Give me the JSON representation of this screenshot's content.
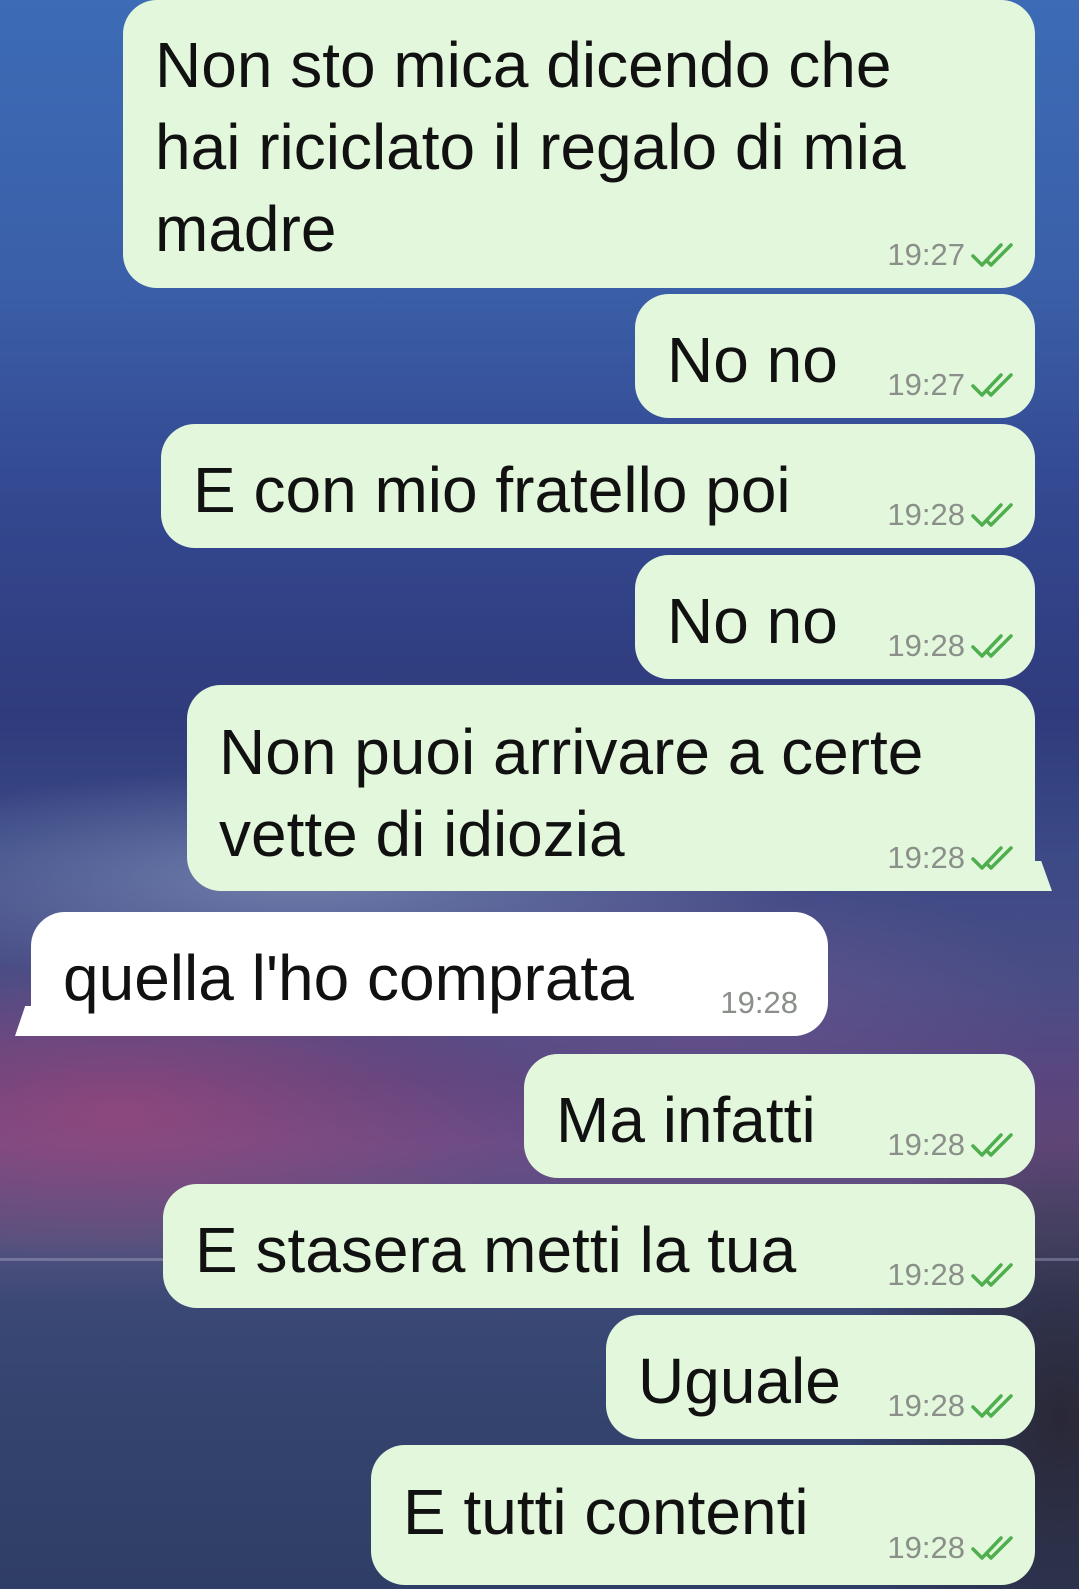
{
  "conversation": {
    "messages": [
      {
        "direction": "outgoing",
        "text": "Non sto mica dicendo che\nhai riciclato il regalo di mia\nmadre",
        "time": "19:27",
        "status": "read-ticks-icon"
      },
      {
        "direction": "outgoing",
        "text": "No no",
        "time": "19:27",
        "status": "read-ticks-icon"
      },
      {
        "direction": "outgoing",
        "text": "E con mio fratello poi",
        "time": "19:28",
        "status": "read-ticks-icon"
      },
      {
        "direction": "outgoing",
        "text": "No no",
        "time": "19:28",
        "status": "read-ticks-icon"
      },
      {
        "direction": "outgoing",
        "text": "Non puoi arrivare a certe\nvette di idiozia",
        "time": "19:28",
        "status": "read-ticks-icon"
      },
      {
        "direction": "incoming",
        "text": "quella l'ho comprata",
        "time": "19:28"
      },
      {
        "direction": "outgoing",
        "text": "Ma infatti",
        "time": "19:28",
        "status": "read-ticks-icon"
      },
      {
        "direction": "outgoing",
        "text": "E stasera metti la tua",
        "time": "19:28",
        "status": "read-ticks-icon"
      },
      {
        "direction": "outgoing",
        "text": "Uguale",
        "time": "19:28",
        "status": "read-ticks-icon"
      },
      {
        "direction": "outgoing",
        "text": "E tutti contenti",
        "time": "19:28",
        "status": "read-ticks-icon"
      }
    ]
  },
  "colors": {
    "outgoing_bubble": "#e3f7dc",
    "incoming_bubble": "#ffffff",
    "tick_green": "#4fae4e",
    "timestamp_gray": "#8a8f8a"
  }
}
